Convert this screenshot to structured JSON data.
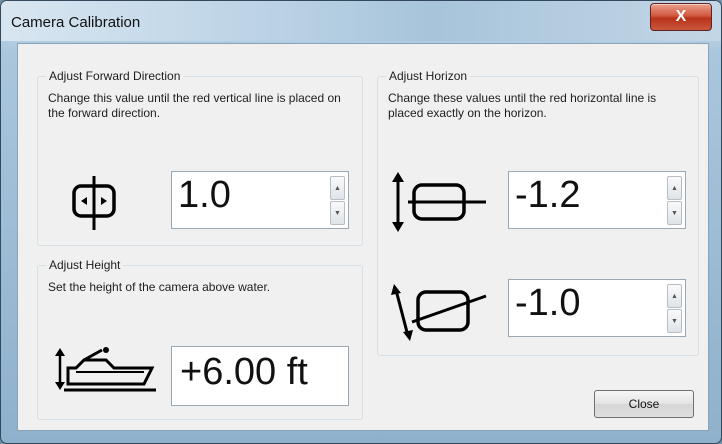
{
  "window": {
    "title": "Camera Calibration",
    "close_glyph": "X"
  },
  "forward": {
    "label": "Adjust Forward Direction",
    "description": "Change this value until the red vertical line is placed on the forward direction.",
    "value": "1.0",
    "icon": "forward-direction-icon"
  },
  "height": {
    "label": "Adjust Height",
    "description": "Set the height of the camera above water.",
    "value": "+6.00 ft",
    "icon": "boat-height-icon"
  },
  "horizon": {
    "label": "Adjust Horizon",
    "description": "Change these values until the red horizontal line is placed exactly on the horizon.",
    "value1": "-1.2",
    "value2": "-1.0",
    "icon1": "horizon-vertical-icon",
    "icon2": "horizon-tilt-icon"
  },
  "spinner": {
    "up": "▲",
    "down": "▼"
  },
  "buttons": {
    "close": "Close"
  }
}
